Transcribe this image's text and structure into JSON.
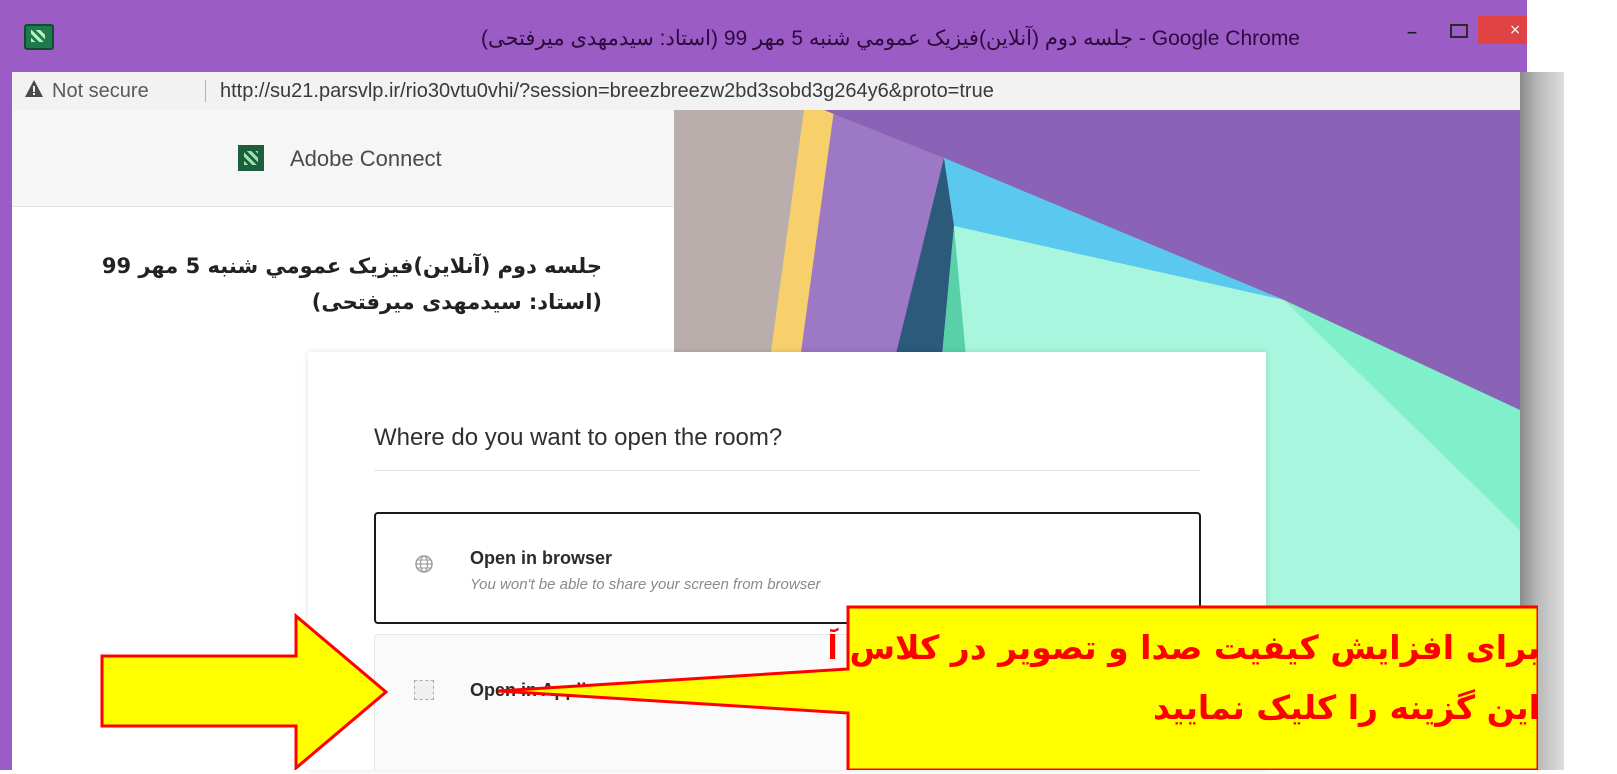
{
  "window": {
    "title": "Google Chrome - جلسه دوم (آنلاین)فیزیک عمومي شنبه 5 مهر 99 (استاد: سیدمهدی میرفتحی)",
    "minimize_glyph": "–",
    "close_glyph": "×",
    "frame_color": "#9b5cc6"
  },
  "addressbar": {
    "security_label": "Not secure",
    "url": "http://su21.parsvlp.ir/rio30vtu0vhi/?session=breezbreezw2bd3sobd3g264y6&proto=true",
    "warning_icon": "warning-triangle-icon"
  },
  "panel": {
    "brand_name": "Adobe Connect",
    "brand_icon": "adobe-connect-logo-icon",
    "meeting_title": "جلسه دوم (آنلاین)فیزیک عمومي شنبه 5 مهر 99 (استاد: سیدمهدی میرفتحی)"
  },
  "dialog": {
    "question": "Where do you want to open the room?",
    "options": [
      {
        "title": "Open in browser",
        "description": "You won't be able to share your screen from browser",
        "icon": "globe-icon",
        "selected": true
      },
      {
        "title": "Open in Application",
        "icon": "application-icon",
        "selected": false
      }
    ]
  },
  "annotation": {
    "callout_line_1": "برای افزایش کیفیت صدا و تصویر در کلاس آنلاین",
    "callout_line_2": "این گزینه را کلیک نمایید",
    "callout_fill": "#ffff00",
    "callout_text_color": "#ff0000",
    "arrow_fill": "#ffff00",
    "arrow_stroke": "#ff0000"
  },
  "colors": {
    "art_purple": "#9d78c4",
    "art_teal": "#7ff0c9",
    "art_blue": "#5bc8ef",
    "art_yellow": "#f7cf6b"
  }
}
